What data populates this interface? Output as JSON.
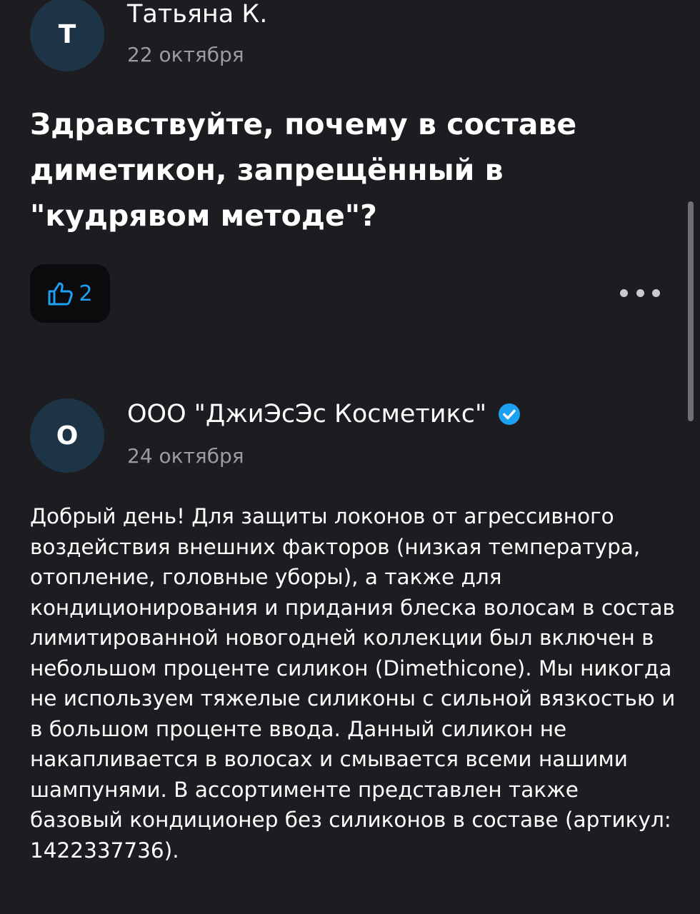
{
  "question": {
    "author": {
      "initial": "Т",
      "name": "Татьяна К.",
      "date": "22 октября"
    },
    "text": "Здравствуйте, почему в составе диметикон, запрещённый в \"кудрявом методе\"?",
    "like_count": "2"
  },
  "answer": {
    "author": {
      "initial": "О",
      "name": "ООО \"ДжиЭсЭс Косметикс\"",
      "date": "24 октября",
      "verified": true
    },
    "text": "Добрый день! Для защиты локонов от агрессивного воздействия внешних факторов (низкая температура, отопление, головные уборы), а также для кондиционирования и придания блеска волосам в состав лимитированной новогодней коллекции был включен в небольшом проценте силикон (Dimethicone). Мы никогда не используем тяжелые силиконы с сильной вязкостью и в большом проценте ввода. Данный силикон не накапливается в волосах и смывается всеми нашими шампунями. В ассортименте представлен также базовый кондиционер без силиконов в составе (артикул: 1422337736)."
  },
  "icons": {
    "like": "thumbs-up-icon",
    "more": "more-dots-icon",
    "verified": "verified-check-icon"
  },
  "colors": {
    "background": "#1c1c21",
    "accent": "#1ca0f2",
    "avatar_bg": "#1d3447",
    "muted_text": "#9a9ca5"
  }
}
